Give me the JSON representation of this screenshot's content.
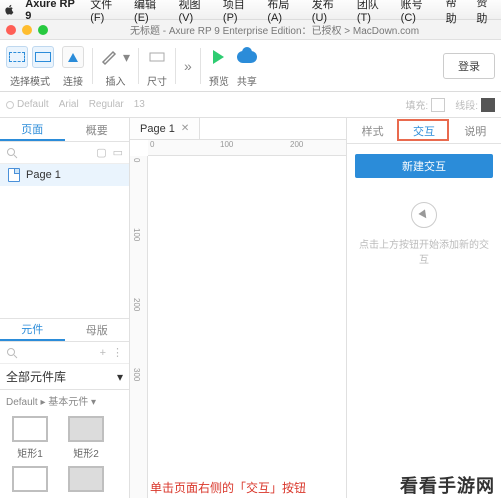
{
  "menubar": {
    "app": "Axure RP 9",
    "items": [
      "文件(F)",
      "编辑(E)",
      "视图(V)",
      "项目(P)",
      "布局(A)",
      "发布(U)",
      "团队(T)",
      "账号(C)",
      "帮助"
    ],
    "right": "赞助"
  },
  "titlebar": {
    "title": "无标题 - Axure RP 9 Enterprise Edition：已授权 > MacDown.com"
  },
  "toolbar": {
    "select_mode": "选择模式",
    "connect": "连接",
    "insert": "插入",
    "dims": "尺寸",
    "preview": "预览",
    "share": "共享",
    "login": "登录"
  },
  "propstrip": {
    "style": "Default",
    "font": "Arial",
    "weight": "Regular",
    "size": "13",
    "fill_label": "填充:",
    "line_label": "线段:"
  },
  "left": {
    "tab_pages": "页面",
    "tab_outline": "概要",
    "page1": "Page 1",
    "tab_widgets": "元件",
    "tab_masters": "母版",
    "lib_all": "全部元件库",
    "lib_group": "Default ▸ 基本元件 ▾",
    "shapes": [
      {
        "label": "矩形1",
        "filled": false
      },
      {
        "label": "矩形2",
        "filled": true
      }
    ]
  },
  "canvas": {
    "tab": "Page 1",
    "h_ticks": [
      "0",
      "100",
      "200"
    ],
    "v_ticks": [
      "0",
      "100",
      "200",
      "300"
    ]
  },
  "inspector": {
    "tab_style": "样式",
    "tab_interact": "交互",
    "tab_notes": "说明",
    "new_interaction": "新建交互",
    "empty_hint": "点击上方按钮开始添加新的交互"
  },
  "footer": {
    "annotation": "单击页面右侧的「交互」按钮",
    "brand": "看看手游网"
  },
  "colors": {
    "accent": "#2b8cd9",
    "highlight": "#e96a4e"
  }
}
